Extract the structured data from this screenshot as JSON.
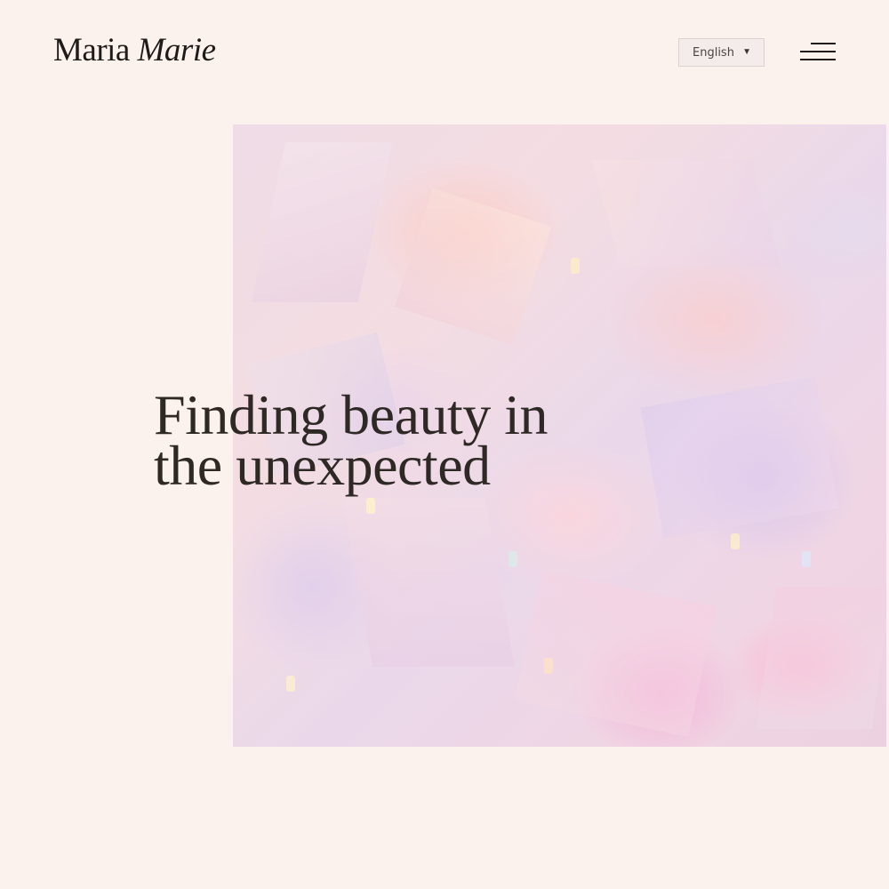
{
  "header": {
    "logo": {
      "name_regular": "Maria",
      "name_italic": "Marie"
    },
    "language_select": {
      "selected": "English",
      "chevron_icon": "chevron-down-icon"
    },
    "menu": {
      "icon": "hamburger-menu-icon"
    }
  },
  "hero": {
    "headline_line_1": "Finding beauty in",
    "headline_line_2": "the unexpected",
    "image": "iridescent-crystal-photo"
  },
  "colors": {
    "background": "#fbf2ee",
    "text": "#2e2925",
    "select_border": "#d9d2ce"
  }
}
